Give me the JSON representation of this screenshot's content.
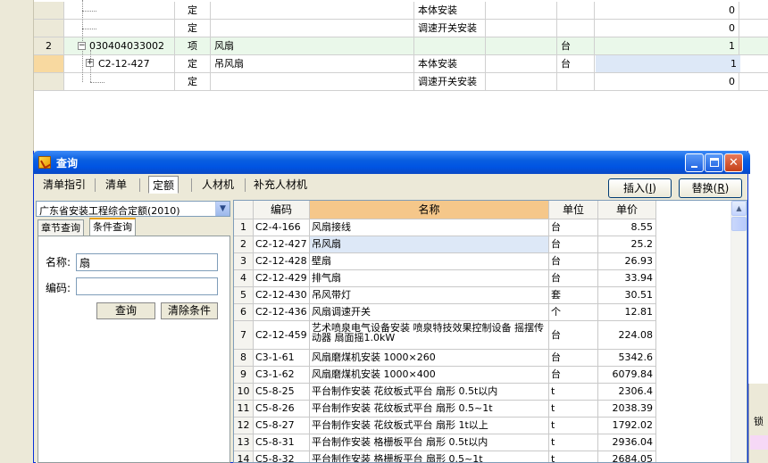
{
  "background_sheet": {
    "rows": [
      {
        "num": "",
        "code": "",
        "type": "定",
        "name": "",
        "feature": "本体安装",
        "unit": "",
        "qty": "0"
      },
      {
        "num": "",
        "code": "",
        "type": "定",
        "name": "",
        "feature": "调速开关安装",
        "unit": "",
        "qty": "0"
      },
      {
        "num": "2",
        "code": "030404033002",
        "type": "项",
        "name": "风扇",
        "feature": "",
        "unit": "台",
        "qty": "1"
      },
      {
        "num": "",
        "code": "C2-12-427",
        "type": "定",
        "name": "吊风扇",
        "feature": "本体安装",
        "unit": "台",
        "qty": "1"
      },
      {
        "num": "",
        "code": "",
        "type": "定",
        "name": "",
        "feature": "调速开关安装",
        "unit": "",
        "qty": "0"
      }
    ],
    "right_strip_label": "锁",
    "colors": {
      "selected_row": "#eaf8ea",
      "orange_marker": "#f8d9a0",
      "qty_highlight": "#dde8f7"
    }
  },
  "dialog": {
    "title": "查询",
    "tabs": [
      "清单指引",
      "清单",
      "定额",
      "人材机",
      "补充人材机"
    ],
    "active_tab": "定额",
    "insert_button": {
      "label": "插入(",
      "hotkey": "I",
      "suffix": ")"
    },
    "replace_button": {
      "label": "替换(",
      "hotkey": "R",
      "suffix": ")"
    },
    "quota_selector": {
      "value": "广东省安装工程综合定额(2010)"
    },
    "subtabs": [
      "章节查询",
      "条件查询"
    ],
    "active_subtab": "条件查询",
    "filter": {
      "name_label": "名称:",
      "name_value": "扇",
      "code_label": "编码:",
      "code_value": "",
      "query_button": "查询",
      "clear_button": "清除条件"
    },
    "results": {
      "headers": {
        "code": "编码",
        "name": "名称",
        "unit": "单位",
        "price": "单价"
      },
      "rows": [
        {
          "idx": "1",
          "code": "C2-4-166",
          "name": "风扇接线",
          "unit": "台",
          "price": "8.55"
        },
        {
          "idx": "2",
          "code": "C2-12-427",
          "name": "吊风扇",
          "unit": "台",
          "price": "25.2"
        },
        {
          "idx": "3",
          "code": "C2-12-428",
          "name": "壁扇",
          "unit": "台",
          "price": "26.93"
        },
        {
          "idx": "4",
          "code": "C2-12-429",
          "name": "排气扇",
          "unit": "台",
          "price": "33.94"
        },
        {
          "idx": "5",
          "code": "C2-12-430",
          "name": "吊风带灯",
          "unit": "套",
          "price": "30.51"
        },
        {
          "idx": "6",
          "code": "C2-12-436",
          "name": "风扇调速开关",
          "unit": "个",
          "price": "12.81"
        },
        {
          "idx": "7",
          "code": "C2-12-459",
          "name": "艺术喷泉电气设备安装 喷泉特技效果控制设备 摇摆传动器 扇面摇1.0kW",
          "unit": "台",
          "price": "224.08"
        },
        {
          "idx": "8",
          "code": "C3-1-61",
          "name": "风扇磨煤机安装 1000×260",
          "unit": "台",
          "price": "5342.6"
        },
        {
          "idx": "9",
          "code": "C3-1-62",
          "name": "风扇磨煤机安装 1000×400",
          "unit": "台",
          "price": "6079.84"
        },
        {
          "idx": "10",
          "code": "C5-8-25",
          "name": "平台制作安装 花纹板式平台 扇形 0.5t以内",
          "unit": "t",
          "price": "2306.4"
        },
        {
          "idx": "11",
          "code": "C5-8-26",
          "name": "平台制作安装 花纹板式平台 扇形 0.5~1t",
          "unit": "t",
          "price": "2038.39"
        },
        {
          "idx": "12",
          "code": "C5-8-27",
          "name": "平台制作安装 花纹板式平台 扇形 1t以上",
          "unit": "t",
          "price": "1792.02"
        },
        {
          "idx": "13",
          "code": "C5-8-31",
          "name": "平台制作安装 格栅板平台 扇形 0.5t以内",
          "unit": "t",
          "price": "2936.04"
        },
        {
          "idx": "14",
          "code": "C5-8-32",
          "name": "平台制作安装 格栅板平台 扇形 0.5~1t",
          "unit": "t",
          "price": "2684.05"
        }
      ],
      "selected_index": 1
    }
  }
}
